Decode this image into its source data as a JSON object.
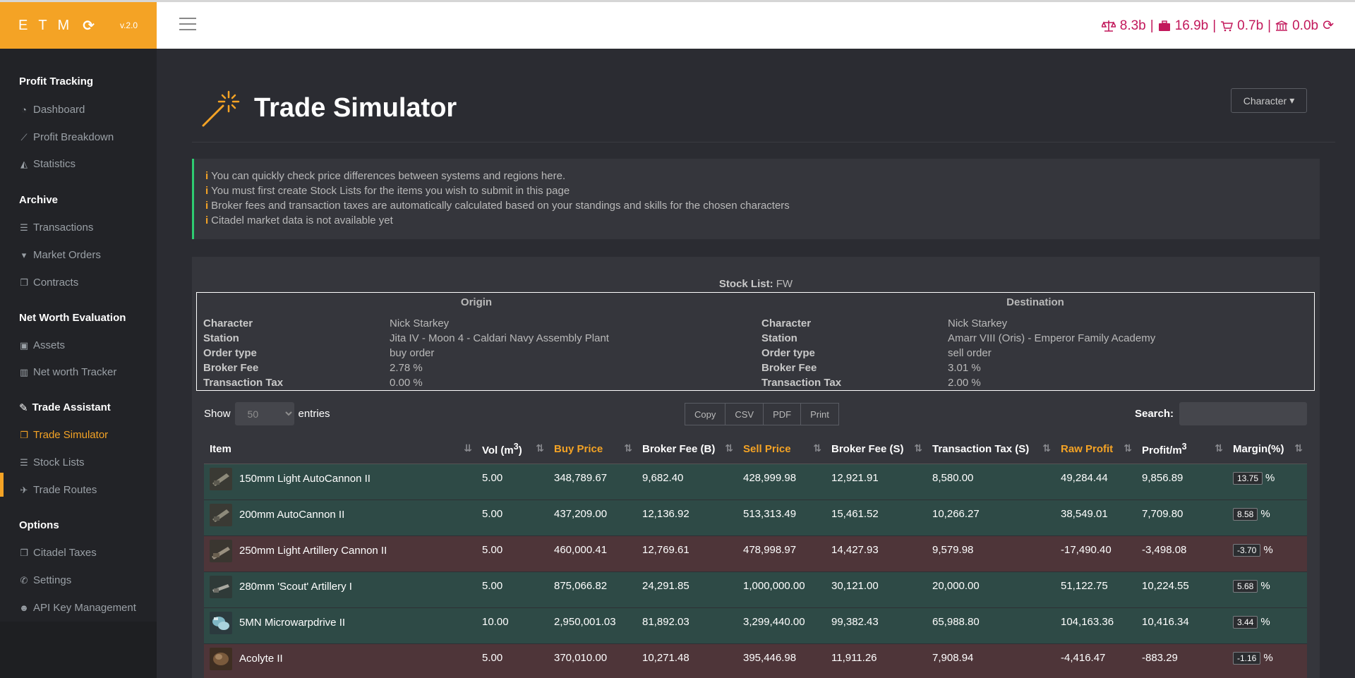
{
  "brand": {
    "logo": "ETM",
    "refresh": "⟳",
    "version": "v.2.0"
  },
  "stats": {
    "wallet": "8.3b",
    "escrow": "16.9b",
    "orders": "0.7b",
    "assets": "0.0b",
    "separator": "|",
    "refresh": "⟳"
  },
  "sidebar": {
    "sections": [
      {
        "title": "Profit Tracking"
      },
      {
        "title": "Archive"
      },
      {
        "title": "Net Worth Evaluation"
      },
      {
        "title": "Trade Assistant"
      },
      {
        "title": "Options"
      }
    ],
    "items": [
      {
        "label": "Dashboard",
        "icon": "dashboard-icon"
      },
      {
        "label": "Profit Breakdown",
        "icon": "line-chart-icon"
      },
      {
        "label": "Statistics",
        "icon": "area-chart-icon"
      },
      {
        "label": "Transactions",
        "icon": "list-icon"
      },
      {
        "label": "Market Orders",
        "icon": "cart-icon"
      },
      {
        "label": "Contracts",
        "icon": "copy-icon"
      },
      {
        "label": "Assets",
        "icon": "briefcase-icon"
      },
      {
        "label": "Net worth Tracker",
        "icon": "bar-chart-icon"
      },
      {
        "label": "Trade Simulator",
        "icon": "copy-icon"
      },
      {
        "label": "Stock Lists",
        "icon": "list-icon"
      },
      {
        "label": "Trade Routes",
        "icon": "plane-icon"
      },
      {
        "label": "Citadel Taxes",
        "icon": "copy-icon"
      },
      {
        "label": "Settings",
        "icon": "wrench-icon"
      },
      {
        "label": "API Key Management",
        "icon": "users-icon"
      }
    ]
  },
  "page": {
    "title": "Trade Simulator",
    "character_button": "Character",
    "character_caret": "▾"
  },
  "info": {
    "glyph": "i",
    "lines": [
      "You can quickly check price differences between systems and regions here.",
      "You must first create Stock Lists for the items you wish to submit in this page",
      "Broker fees and transaction taxes are automatically calculated based on your standings and skills for the chosen characters",
      "Citadel market data is not available yet"
    ]
  },
  "stock_list": {
    "label": "Stock List:",
    "name": "FW"
  },
  "origin": {
    "heading": "Origin",
    "rows": [
      {
        "label": "Character",
        "value": "Nick Starkey"
      },
      {
        "label": "Station",
        "value": "Jita IV - Moon 4 - Caldari Navy Assembly Plant"
      },
      {
        "label": "Order type",
        "value": "buy order"
      },
      {
        "label": "Broker Fee",
        "value": "2.78 %"
      },
      {
        "label": "Transaction Tax",
        "value": "0.00 %"
      }
    ]
  },
  "destination": {
    "heading": "Destination",
    "rows": [
      {
        "label": "Character",
        "value": "Nick Starkey"
      },
      {
        "label": "Station",
        "value": "Amarr VIII (Oris) - Emperor Family Academy"
      },
      {
        "label": "Order type",
        "value": "sell order"
      },
      {
        "label": "Broker Fee",
        "value": "3.01 %"
      },
      {
        "label": "Transaction Tax",
        "value": "2.00 %"
      }
    ]
  },
  "controls": {
    "show_label": "Show",
    "show_value": "50",
    "entries_label": "entries",
    "copy": "Copy",
    "csv": "CSV",
    "pdf": "PDF",
    "print": "Print",
    "search_label": "Search:",
    "search_value": ""
  },
  "table": {
    "sort_glyph": "⇅",
    "sort_active_glyph": "⇊",
    "headers": {
      "item": "Item",
      "vol": "Vol (m",
      "vol_sup": "3",
      "vol_end": ")",
      "buy": "Buy Price",
      "broker_b": "Broker Fee (B)",
      "sell": "Sell Price",
      "broker_s": "Broker Fee (S)",
      "tax_s": "Transaction Tax (S)",
      "raw": "Raw Profit",
      "profit_m": "Profit/m",
      "profit_sup": "3",
      "margin": "Margin(%)"
    },
    "rows": [
      {
        "item": "150mm Light AutoCannon II",
        "vol": "5.00",
        "buy": "348,789.67",
        "broker_b": "9,682.40",
        "sell": "428,999.98",
        "broker_s": "12,921.91",
        "tax_s": "8,580.00",
        "raw": "49,284.44",
        "profit_m": "9,856.89",
        "margin": "13.75",
        "pct": "%"
      },
      {
        "item": "200mm AutoCannon II",
        "vol": "5.00",
        "buy": "437,209.00",
        "broker_b": "12,136.92",
        "sell": "513,313.49",
        "broker_s": "15,461.52",
        "tax_s": "10,266.27",
        "raw": "38,549.01",
        "profit_m": "7,709.80",
        "margin": "8.58",
        "pct": "%"
      },
      {
        "item": "250mm Light Artillery Cannon II",
        "vol": "5.00",
        "buy": "460,000.41",
        "broker_b": "12,769.61",
        "sell": "478,998.97",
        "broker_s": "14,427.93",
        "tax_s": "9,579.98",
        "raw": "-17,490.40",
        "profit_m": "-3,498.08",
        "margin": "-3.70",
        "pct": "%"
      },
      {
        "item": "280mm 'Scout' Artillery I",
        "vol": "5.00",
        "buy": "875,066.82",
        "broker_b": "24,291.85",
        "sell": "1,000,000.00",
        "broker_s": "30,121.00",
        "tax_s": "20,000.00",
        "raw": "51,122.75",
        "profit_m": "10,224.55",
        "margin": "5.68",
        "pct": "%"
      },
      {
        "item": "5MN Microwarpdrive II",
        "vol": "10.00",
        "buy": "2,950,001.03",
        "broker_b": "81,892.03",
        "sell": "3,299,440.00",
        "broker_s": "99,382.43",
        "tax_s": "65,988.80",
        "raw": "104,163.36",
        "profit_m": "10,416.34",
        "margin": "3.44",
        "pct": "%"
      },
      {
        "item": "Acolyte II",
        "vol": "5.00",
        "buy": "370,010.00",
        "broker_b": "10,271.48",
        "sell": "395,446.98",
        "broker_s": "11,911.26",
        "tax_s": "7,908.94",
        "raw": "-4,416.47",
        "profit_m": "-883.29",
        "margin": "-1.16",
        "pct": "%"
      }
    ]
  },
  "colors": {
    "accent": "#f4a325",
    "stats_red": "#c2185b",
    "row_positive": "#2e4a46",
    "row_negative": "#4e3539",
    "info_border": "#2ecc71"
  }
}
